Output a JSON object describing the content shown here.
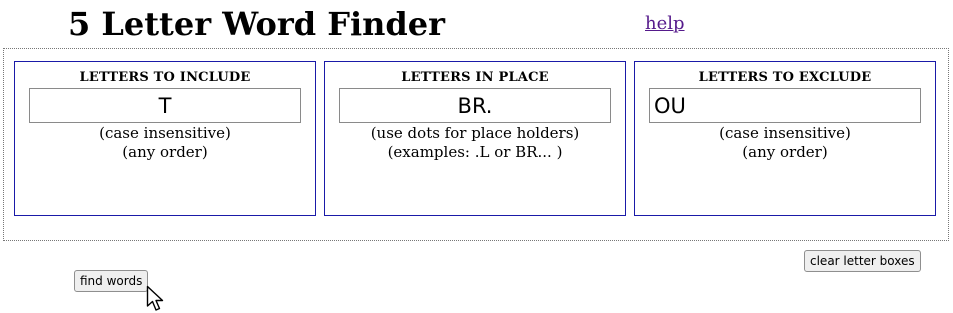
{
  "header": {
    "title": "5 Letter Word Finder",
    "help_label": "help"
  },
  "panels": [
    {
      "heading": "LETTERS TO INCLUDE",
      "value": "T",
      "hints": [
        "(case insensitive)",
        "(any order)"
      ]
    },
    {
      "heading": "LETTERS IN PLACE",
      "value": "BR.",
      "hints": [
        "(use dots for place holders)",
        "(examples: .L or BR... )"
      ]
    },
    {
      "heading": "LETTERS TO EXCLUDE",
      "value": "OU",
      "hints": [
        "(case insensitive)",
        "(any order)"
      ]
    }
  ],
  "actions": {
    "find_label": "find words",
    "clear_label": "clear letter boxes"
  },
  "icons": {
    "cursor": "mouse-pointer-icon"
  },
  "colors": {
    "panel_border": "#1a1aa8",
    "link": "#551a8b",
    "outer_border": "#777777"
  }
}
